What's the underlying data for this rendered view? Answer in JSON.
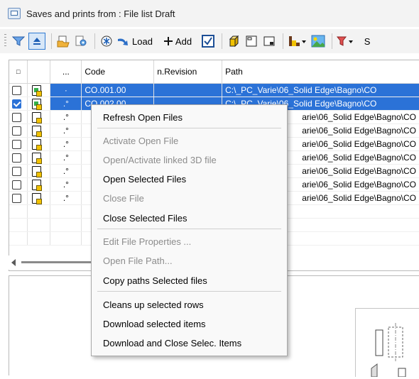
{
  "window": {
    "title": "Saves and prints from : File list Draft"
  },
  "toolbar": {
    "load_label": "Load",
    "add_label": "Add",
    "trailing_char": "S"
  },
  "grid": {
    "headers": [
      "□",
      "",
      "...",
      "Code",
      "n.Revision",
      "Path"
    ],
    "rows": [
      {
        "checked": false,
        "selected": true,
        "dot": "·",
        "code": "CO.001.00",
        "revision": "",
        "path": "C:\\_PC_Varie\\06_Solid Edge\\Bagno\\CO"
      },
      {
        "checked": true,
        "selected": true,
        "dot": ".°",
        "code": "CO.002.00",
        "revision": "",
        "path": "C:\\_PC_Varie\\06_Solid Edge\\Bagno\\CO"
      },
      {
        "checked": false,
        "selected": false,
        "dot": ".°",
        "code": "",
        "revision": "",
        "path": "arie\\06_Solid Edge\\Bagno\\CO"
      },
      {
        "checked": false,
        "selected": false,
        "dot": ".°",
        "code": "",
        "revision": "",
        "path": "arie\\06_Solid Edge\\Bagno\\CO"
      },
      {
        "checked": false,
        "selected": false,
        "dot": ".°",
        "code": "",
        "revision": "",
        "path": "arie\\06_Solid Edge\\Bagno\\CO"
      },
      {
        "checked": false,
        "selected": false,
        "dot": ".°",
        "code": "",
        "revision": "",
        "path": "arie\\06_Solid Edge\\Bagno\\CO"
      },
      {
        "checked": false,
        "selected": false,
        "dot": ".°",
        "code": "",
        "revision": "",
        "path": "arie\\06_Solid Edge\\Bagno\\CO"
      },
      {
        "checked": false,
        "selected": false,
        "dot": ".°",
        "code": "",
        "revision": "",
        "path": "arie\\06_Solid Edge\\Bagno\\CO"
      },
      {
        "checked": false,
        "selected": false,
        "dot": ".°",
        "code": "",
        "revision": "",
        "path": "arie\\06_Solid Edge\\Bagno\\CO"
      }
    ]
  },
  "context_menu": {
    "items": [
      {
        "label": "Refresh Open Files",
        "enabled": true
      },
      {
        "label": "Activate Open File",
        "enabled": false
      },
      {
        "label": "Open/Activate linked 3D file",
        "enabled": false
      },
      {
        "label": "Open Selected Files",
        "enabled": true
      },
      {
        "label": "Close File",
        "enabled": false
      },
      {
        "label": "Close Selected Files",
        "enabled": true
      },
      {
        "label": "Edit File Properties ...",
        "enabled": false
      },
      {
        "label": "Open File Path...",
        "enabled": false
      },
      {
        "label": "Copy paths Selected files",
        "enabled": true
      },
      {
        "label": "Cleans up selected rows",
        "enabled": true
      },
      {
        "label": "Download selected items",
        "enabled": true
      },
      {
        "label": "Download and Close Selec. Items",
        "enabled": true
      }
    ]
  },
  "colors": {
    "selection": "#2b72d7",
    "accent": "#2f7ad3",
    "disabled_text": "#8c8c8c"
  }
}
